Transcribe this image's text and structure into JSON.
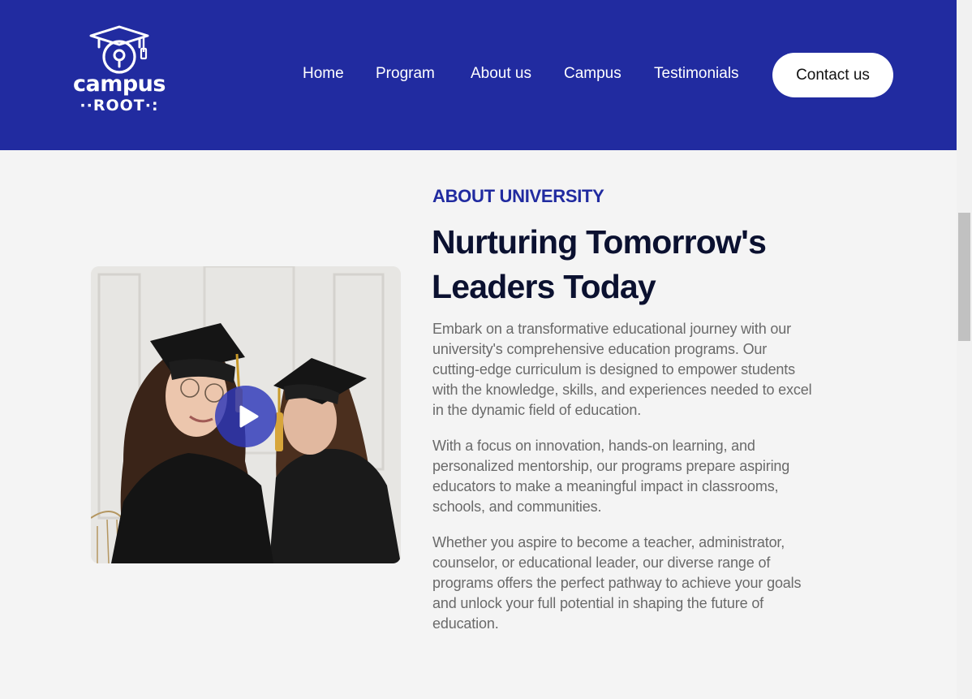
{
  "header": {
    "logo": {
      "line1": "campus",
      "line2": "ROOT",
      "icon": "graduation-cap-magnifier-icon"
    },
    "nav": [
      {
        "label": "Home"
      },
      {
        "label": "Program"
      },
      {
        "label": "About us"
      },
      {
        "label": "Campus"
      },
      {
        "label": "Testimonials"
      }
    ],
    "contact_label": "Contact us"
  },
  "colors": {
    "brand_blue": "#212ba0",
    "heading_dark": "#0b1130",
    "body_text": "#6a6a6a",
    "background": "#f4f4f4"
  },
  "about": {
    "eyebrow": "ABOUT UNIVERSITY",
    "heading_lines": [
      "Nurturing Tomorrow's",
      "Leaders Today"
    ],
    "paragraphs": [
      [
        "Embark on a transformative educational journey with our",
        "university's comprehensive education programs. Our",
        "cutting-edge curriculum is designed to empower students",
        "with the knowledge, skills, and experiences needed to excel",
        "in the dynamic field of education."
      ],
      [
        "With a focus on innovation, hands-on learning, and",
        "personalized mentorship, our programs prepare aspiring",
        "educators to make a meaningful impact in classrooms,",
        "schools, and communities."
      ],
      [
        "Whether you aspire to become a teacher, administrator,",
        "counselor, or educational leader, our diverse range of",
        "programs offers the perfect pathway to achieve your goals",
        "and unlock your full potential in shaping the future of",
        "education."
      ]
    ],
    "media": {
      "image": "two-graduates-photo",
      "play_icon": "play-icon"
    }
  }
}
